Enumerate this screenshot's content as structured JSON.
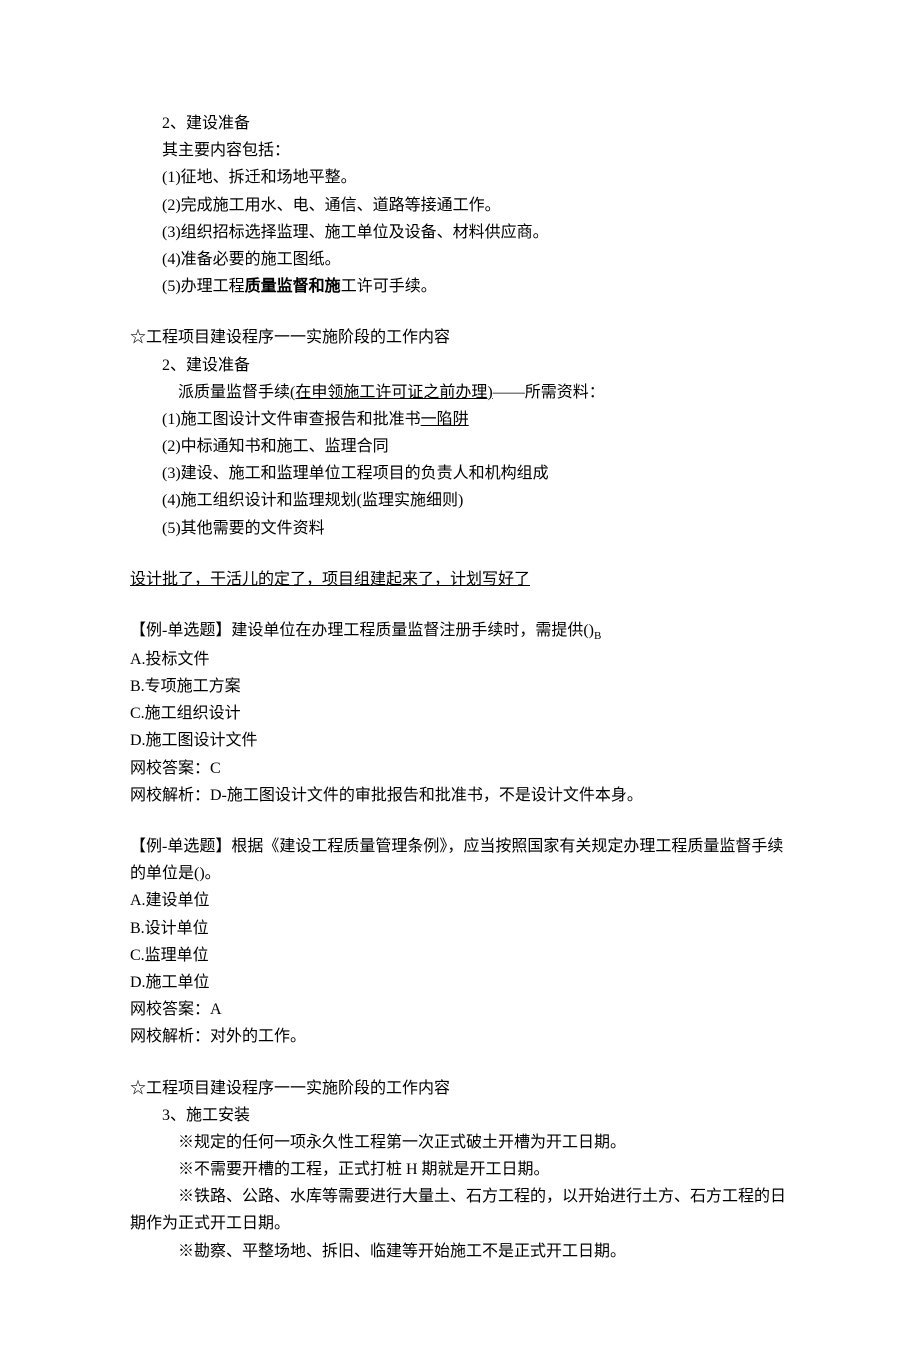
{
  "section1": {
    "title": "2、建设准备",
    "subtitle": "其主要内容包括：",
    "items": [
      "(1)征地、拆迁和场地平整。",
      "(2)完成施工用水、电、通信、道路等接通工作。",
      "(3)组织招标选择监理、施工单位及设备、材料供应商。",
      "(4)准备必要的施工图纸。"
    ],
    "item5_pre": "(5)办理工程",
    "item5_bold": "质量监督和施",
    "item5_post": "工许可手续。"
  },
  "section2": {
    "heading": "☆工程项目建设程序一一实施阶段的工作内容",
    "title": "2、建设准备",
    "subtext_pre": "派质量监督手续",
    "subtext_underline": "(在申领施工许可证之前办理)",
    "subtext_post": "——所需资料：",
    "item1_pre": "(1)施工图设计文件审查报告和批准书",
    "item1_underline": "一陷阱",
    "items": [
      "(2)中标通知书和施工、监理合同",
      "(3)建设、施工和监理单位工程项目的负责人和机构组成",
      "(4)施工组织设计和监理规划(监理实施细则)",
      "(5)其他需要的文件资料"
    ]
  },
  "summary": "设计批了，干活儿的定了，项目组建起来了，计划写好了",
  "question1": {
    "prompt_pre": "【例-单选题】建设单位在办理工程质量监督注册手续时，需提供()",
    "prompt_sub": "B",
    "options": [
      "A.投标文件",
      "B.专项施工方案",
      "C.施工组织设计",
      "D.施工图设计文件"
    ],
    "answer": "网校答案：C",
    "analysis": "网校解析：D-施工图设计文件的审批报告和批准书，不是设计文件本身。"
  },
  "question2": {
    "prompt": "【例-单选题】根据《建设工程质量管理条例》，应当按照国家有关规定办理工程质量监督手续的单位是()。",
    "options": [
      "A.建设单位",
      "B.设计单位",
      "C.监理单位",
      "D.施工单位"
    ],
    "answer": "网校答案：A",
    "analysis": "网校解析：对外的工作。"
  },
  "section3": {
    "heading": "☆工程项目建设程序一一实施阶段的工作内容",
    "title": "3、施工安装",
    "items": [
      "※规定的任何一项永久性工程第一次正式破土开槽为开工日期。",
      "※不需要开槽的工程，正式打桩 H 期就是开工日期。",
      "※铁路、公路、水库等需要进行大量土、石方工程的，以开始进行土方、石方工程的日期作为正式开工日期。",
      "※勘察、平整场地、拆旧、临建等开始施工不是正式开工日期。"
    ]
  }
}
